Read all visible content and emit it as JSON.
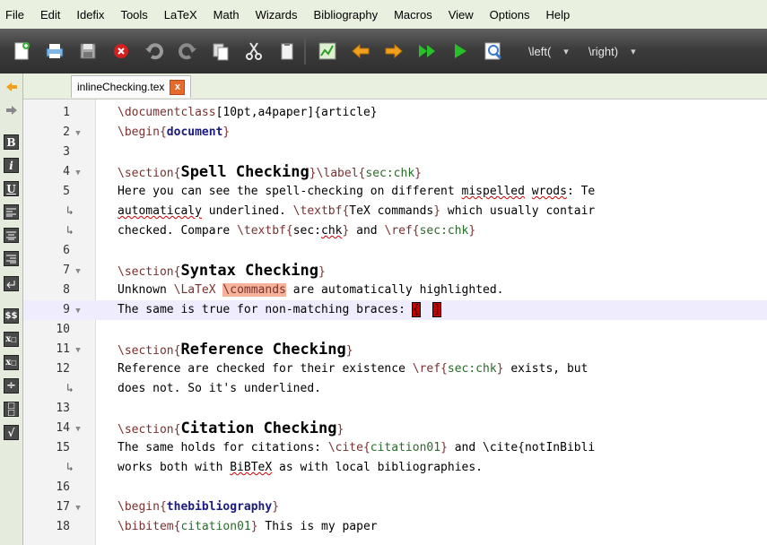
{
  "menu": [
    "File",
    "Edit",
    "Idefix",
    "Tools",
    "LaTeX",
    "Math",
    "Wizards",
    "Bibliography",
    "Macros",
    "View",
    "Options",
    "Help"
  ],
  "toolbar": {
    "icons": [
      "new-file",
      "save-all",
      "save",
      "close-document",
      "undo",
      "redo",
      "copy",
      "cut",
      "paste",
      "compile",
      "back",
      "forward",
      "build-run",
      "run",
      "view-zoom"
    ],
    "left_delim": "\\left(",
    "right_delim": "\\right)"
  },
  "leftbar": {
    "items": [
      "arrow-left",
      "arrow-right",
      "B",
      "i",
      "U",
      "left-align",
      "center-align",
      "right-align",
      "newline",
      "$$",
      "subscript",
      "superscript",
      "frac",
      "stackrel",
      "sqrt"
    ]
  },
  "tab": {
    "filename": "inlineChecking.tex",
    "close": "x"
  },
  "lines": [
    {
      "n": "1",
      "fold": false,
      "text": "\\documentclass[10pt,a4paper]{article}"
    },
    {
      "n": "2",
      "fold": true,
      "text": "\\begin{document}"
    },
    {
      "n": "3",
      "fold": false,
      "text": ""
    },
    {
      "n": "4",
      "fold": true,
      "text": "\\section{Spell Checking}\\label{sec:chk}"
    },
    {
      "n": "5",
      "fold": false,
      "text": "Here you can see the spell-checking on different mispelled wrods: Te"
    },
    {
      "n": "",
      "wrap": true,
      "text": "automaticaly underlined. \\textbf{TeX commands} which usually contair"
    },
    {
      "n": "",
      "wrap": true,
      "text": "checked. Compare \\textbf{sec:chk} and \\ref{sec:chk}"
    },
    {
      "n": "6",
      "fold": false,
      "text": ""
    },
    {
      "n": "7",
      "fold": true,
      "text": "\\section{Syntax Checking}"
    },
    {
      "n": "8",
      "fold": false,
      "text": "Unknown \\LaTeX \\commands are automatically highlighted."
    },
    {
      "n": "9",
      "fold": true,
      "text": "The same is true for non-matching braces: {  ]"
    },
    {
      "n": "10",
      "fold": false,
      "text": ""
    },
    {
      "n": "11",
      "fold": true,
      "text": "\\section{Reference Checking}"
    },
    {
      "n": "12",
      "fold": false,
      "text": "Reference are checked for their existence \\ref{sec:chk} exists, but"
    },
    {
      "n": "",
      "wrap": true,
      "text": "does not. So it's underlined."
    },
    {
      "n": "13",
      "fold": false,
      "text": ""
    },
    {
      "n": "14",
      "fold": true,
      "text": "\\section{Citation Checking}"
    },
    {
      "n": "15",
      "fold": false,
      "text": "The same holds for citations: \\cite{citation01} and \\cite{notInBibli"
    },
    {
      "n": "",
      "wrap": true,
      "text": "works both with BiBTeX as with local bibliographies."
    },
    {
      "n": "16",
      "fold": false,
      "text": ""
    },
    {
      "n": "17",
      "fold": true,
      "text": "\\begin{thebibliography}"
    },
    {
      "n": "18",
      "fold": false,
      "text": "\\bibitem{citation01} This is my paper"
    }
  ],
  "colors": {
    "command": "#7a3030",
    "keyword": "#1a1a80",
    "argument": "#2a6a2a",
    "highlight": "#f6b39a",
    "current_line": "#efedfd",
    "tab_close": "#e66a2c"
  }
}
